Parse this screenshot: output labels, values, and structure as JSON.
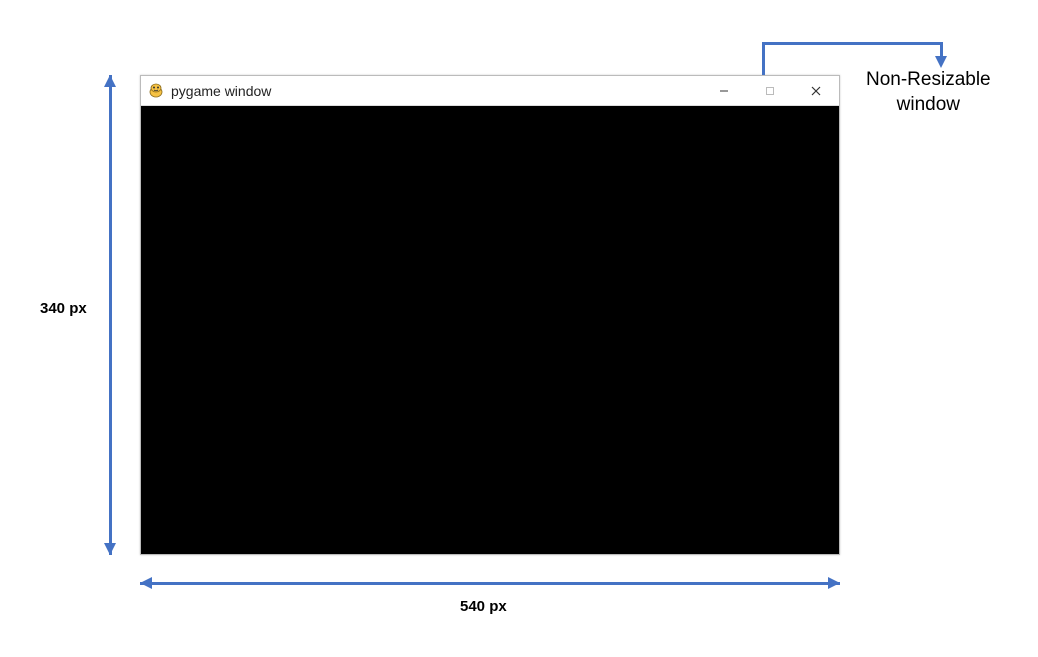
{
  "window": {
    "title": "pygame window",
    "client_background": "#000000",
    "controls": {
      "minimize_enabled": true,
      "maximize_enabled": false,
      "close_enabled": true
    }
  },
  "dimensions": {
    "height_label": "340 px",
    "width_label": "540 px"
  },
  "annotation": {
    "callout_line1": "Non-Resizable",
    "callout_line2": "window"
  },
  "colors": {
    "arrow": "#4472C4"
  }
}
